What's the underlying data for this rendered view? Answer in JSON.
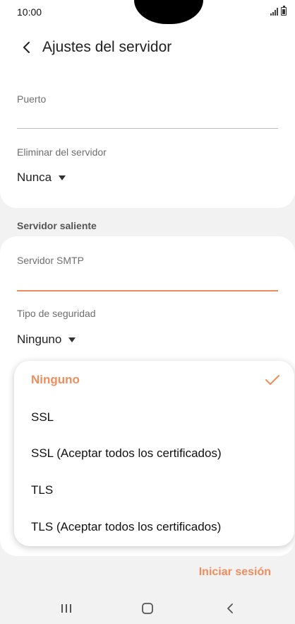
{
  "status_bar": {
    "time": "10:00"
  },
  "header": {
    "title": "Ajustes del servidor"
  },
  "incoming": {
    "port_label": "Puerto",
    "port_value": "",
    "delete_label": "Eliminar del servidor",
    "delete_value": "Nunca"
  },
  "outgoing": {
    "section_title": "Servidor saliente",
    "smtp_label": "Servidor SMTP",
    "smtp_value": "",
    "security_label": "Tipo de seguridad",
    "security_value": "Ninguno"
  },
  "security_menu": {
    "options": [
      {
        "label": "Ninguno",
        "selected": true
      },
      {
        "label": "SSL",
        "selected": false
      },
      {
        "label": "SSL (Aceptar todos los certificados)",
        "selected": false
      },
      {
        "label": "TLS",
        "selected": false
      },
      {
        "label": "TLS (Aceptar todos los certificados)",
        "selected": false
      }
    ]
  },
  "footer": {
    "signin_label": "Iniciar sesión"
  },
  "colors": {
    "accent": "#f08d5d",
    "background": "#f2f2f2",
    "card": "#ffffff"
  },
  "icons": [
    "back-arrow-icon",
    "signal-icon",
    "battery-icon",
    "dropdown-arrow-icon",
    "check-icon",
    "recents-icon",
    "home-icon",
    "nav-back-icon"
  ]
}
